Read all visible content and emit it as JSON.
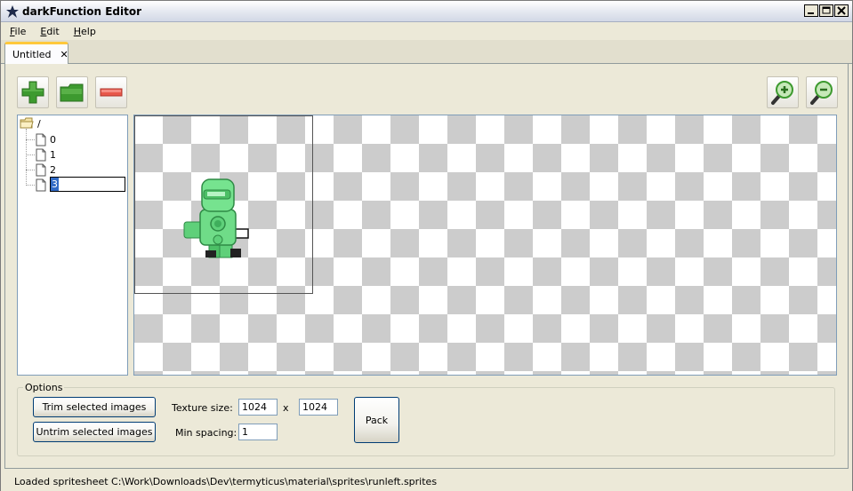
{
  "window": {
    "title": "darkFunction Editor"
  },
  "menu": [
    {
      "label": "File",
      "mnemonic": "F",
      "rest": "ile"
    },
    {
      "label": "Edit",
      "mnemonic": "E",
      "rest": "dit"
    },
    {
      "label": "Help",
      "mnemonic": "H",
      "rest": "elp"
    }
  ],
  "tab": {
    "label": "Untitled",
    "close_glyph": "✕"
  },
  "toolbar": {
    "add_icon": "plus-icon",
    "open_icon": "folder-icon",
    "remove_icon": "minus-icon",
    "zoom_in_icon": "zoom-in-icon",
    "zoom_out_icon": "zoom-out-icon"
  },
  "tree": {
    "root": "/",
    "items": [
      "0",
      "1",
      "2"
    ],
    "editing_value": "3"
  },
  "options": {
    "legend": "Options",
    "trim_label": "Trim selected images",
    "untrim_label": "Untrim selected images",
    "texture_size_label": "Texture size:",
    "texture_width": "1024",
    "times": "x",
    "texture_height": "1024",
    "min_spacing_label": "Min spacing:",
    "min_spacing": "1",
    "pack_label": "Pack"
  },
  "status": {
    "text": "Loaded spritesheet C:\\Work\\Downloads\\Dev\\termyticus\\material\\sprites\\runleft.sprites"
  },
  "colors": {
    "accent_tab": "#ffc83c",
    "sprite_green": "#5fd07a",
    "add_green": "#3d9a2f",
    "remove_red": "#e8574a"
  }
}
